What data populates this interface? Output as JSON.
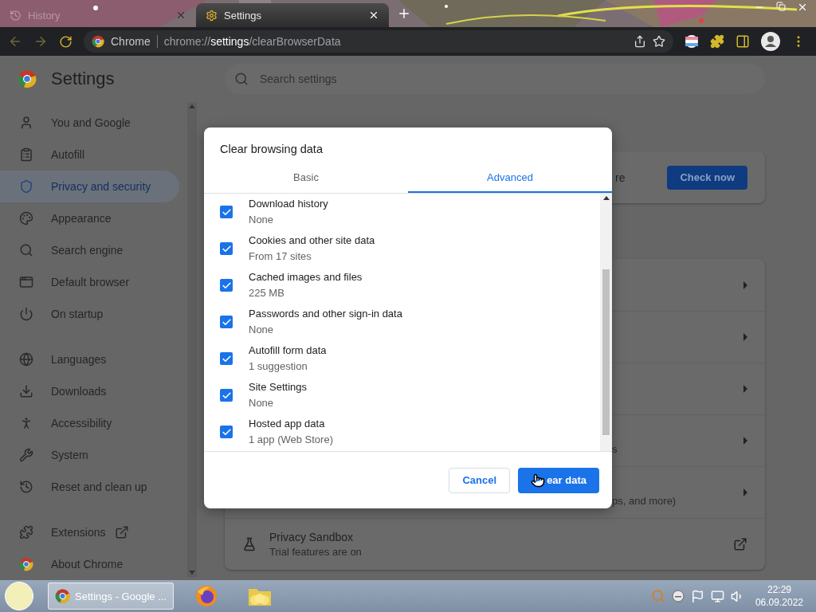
{
  "browser": {
    "tabs": [
      {
        "title": "History",
        "selected": false
      },
      {
        "title": "Settings",
        "selected": true
      }
    ],
    "omnibox": {
      "site_label": "Chrome",
      "url": "chrome://**settings**/clearBrowserData"
    }
  },
  "settings": {
    "title": "Settings",
    "search": {
      "placeholder": "Search settings"
    },
    "sidebar": {
      "groups": [
        {
          "items": [
            {
              "label": "You and Google",
              "selected": false,
              "external": false
            },
            {
              "label": "Autofill",
              "selected": false,
              "external": false
            },
            {
              "label": "Privacy and security",
              "selected": true,
              "external": false
            },
            {
              "label": "Appearance",
              "selected": false,
              "external": false
            },
            {
              "label": "Search engine",
              "selected": false,
              "external": false
            },
            {
              "label": "Default browser",
              "selected": false,
              "external": false
            },
            {
              "label": "On startup",
              "selected": false,
              "external": false
            }
          ]
        },
        {
          "items": [
            {
              "label": "Languages",
              "selected": false,
              "external": false
            },
            {
              "label": "Downloads",
              "selected": false,
              "external": false
            },
            {
              "label": "Accessibility",
              "selected": false,
              "external": false
            },
            {
              "label": "System",
              "selected": false,
              "external": false
            },
            {
              "label": "Reset and clean up",
              "selected": false,
              "external": false
            }
          ]
        },
        {
          "items": [
            {
              "label": "Extensions",
              "selected": false,
              "external": true
            },
            {
              "label": "About Chrome",
              "selected": false,
              "external": false
            }
          ]
        }
      ]
    },
    "cards": [
      {
        "rows": [
          {
            "kind": "action",
            "text": "re",
            "button": "Check now"
          }
        ]
      },
      {
        "rows": [
          {
            "kind": "arrow"
          },
          {
            "kind": "arrow"
          },
          {
            "kind": "arrow"
          },
          {
            "kind": "arrow",
            "subtitle": "s"
          },
          {
            "kind": "arrow",
            "subtitle": "ps, and more)"
          },
          {
            "kind": "external",
            "title": "Privacy Sandbox",
            "subtitle": "Trial features are on"
          }
        ]
      }
    ]
  },
  "dialog": {
    "title": "Clear browsing data",
    "tabs": [
      {
        "label": "Basic",
        "selected": false
      },
      {
        "label": "Advanced",
        "selected": true
      }
    ],
    "items": [
      {
        "label": "Download history",
        "detail": "None",
        "checked": true
      },
      {
        "label": "Cookies and other site data",
        "detail": "From 17 sites",
        "checked": true
      },
      {
        "label": "Cached images and files",
        "detail": "225 MB",
        "checked": true
      },
      {
        "label": "Passwords and other sign-in data",
        "detail": "None",
        "checked": true
      },
      {
        "label": "Autofill form data",
        "detail": "1 suggestion",
        "checked": true
      },
      {
        "label": "Site Settings",
        "detail": "None",
        "checked": true
      },
      {
        "label": "Hosted app data",
        "detail": "1 app (Web Store)",
        "checked": true
      }
    ],
    "buttons": [
      {
        "label": "Cancel",
        "kind": "secondary"
      },
      {
        "label": "ear data",
        "kind": "primary"
      }
    ]
  },
  "taskbar": {
    "task": {
      "label": "Settings - Google ...",
      "selected": true
    },
    "clock": {
      "time": "22:29",
      "date": "06.09.2022"
    }
  }
}
